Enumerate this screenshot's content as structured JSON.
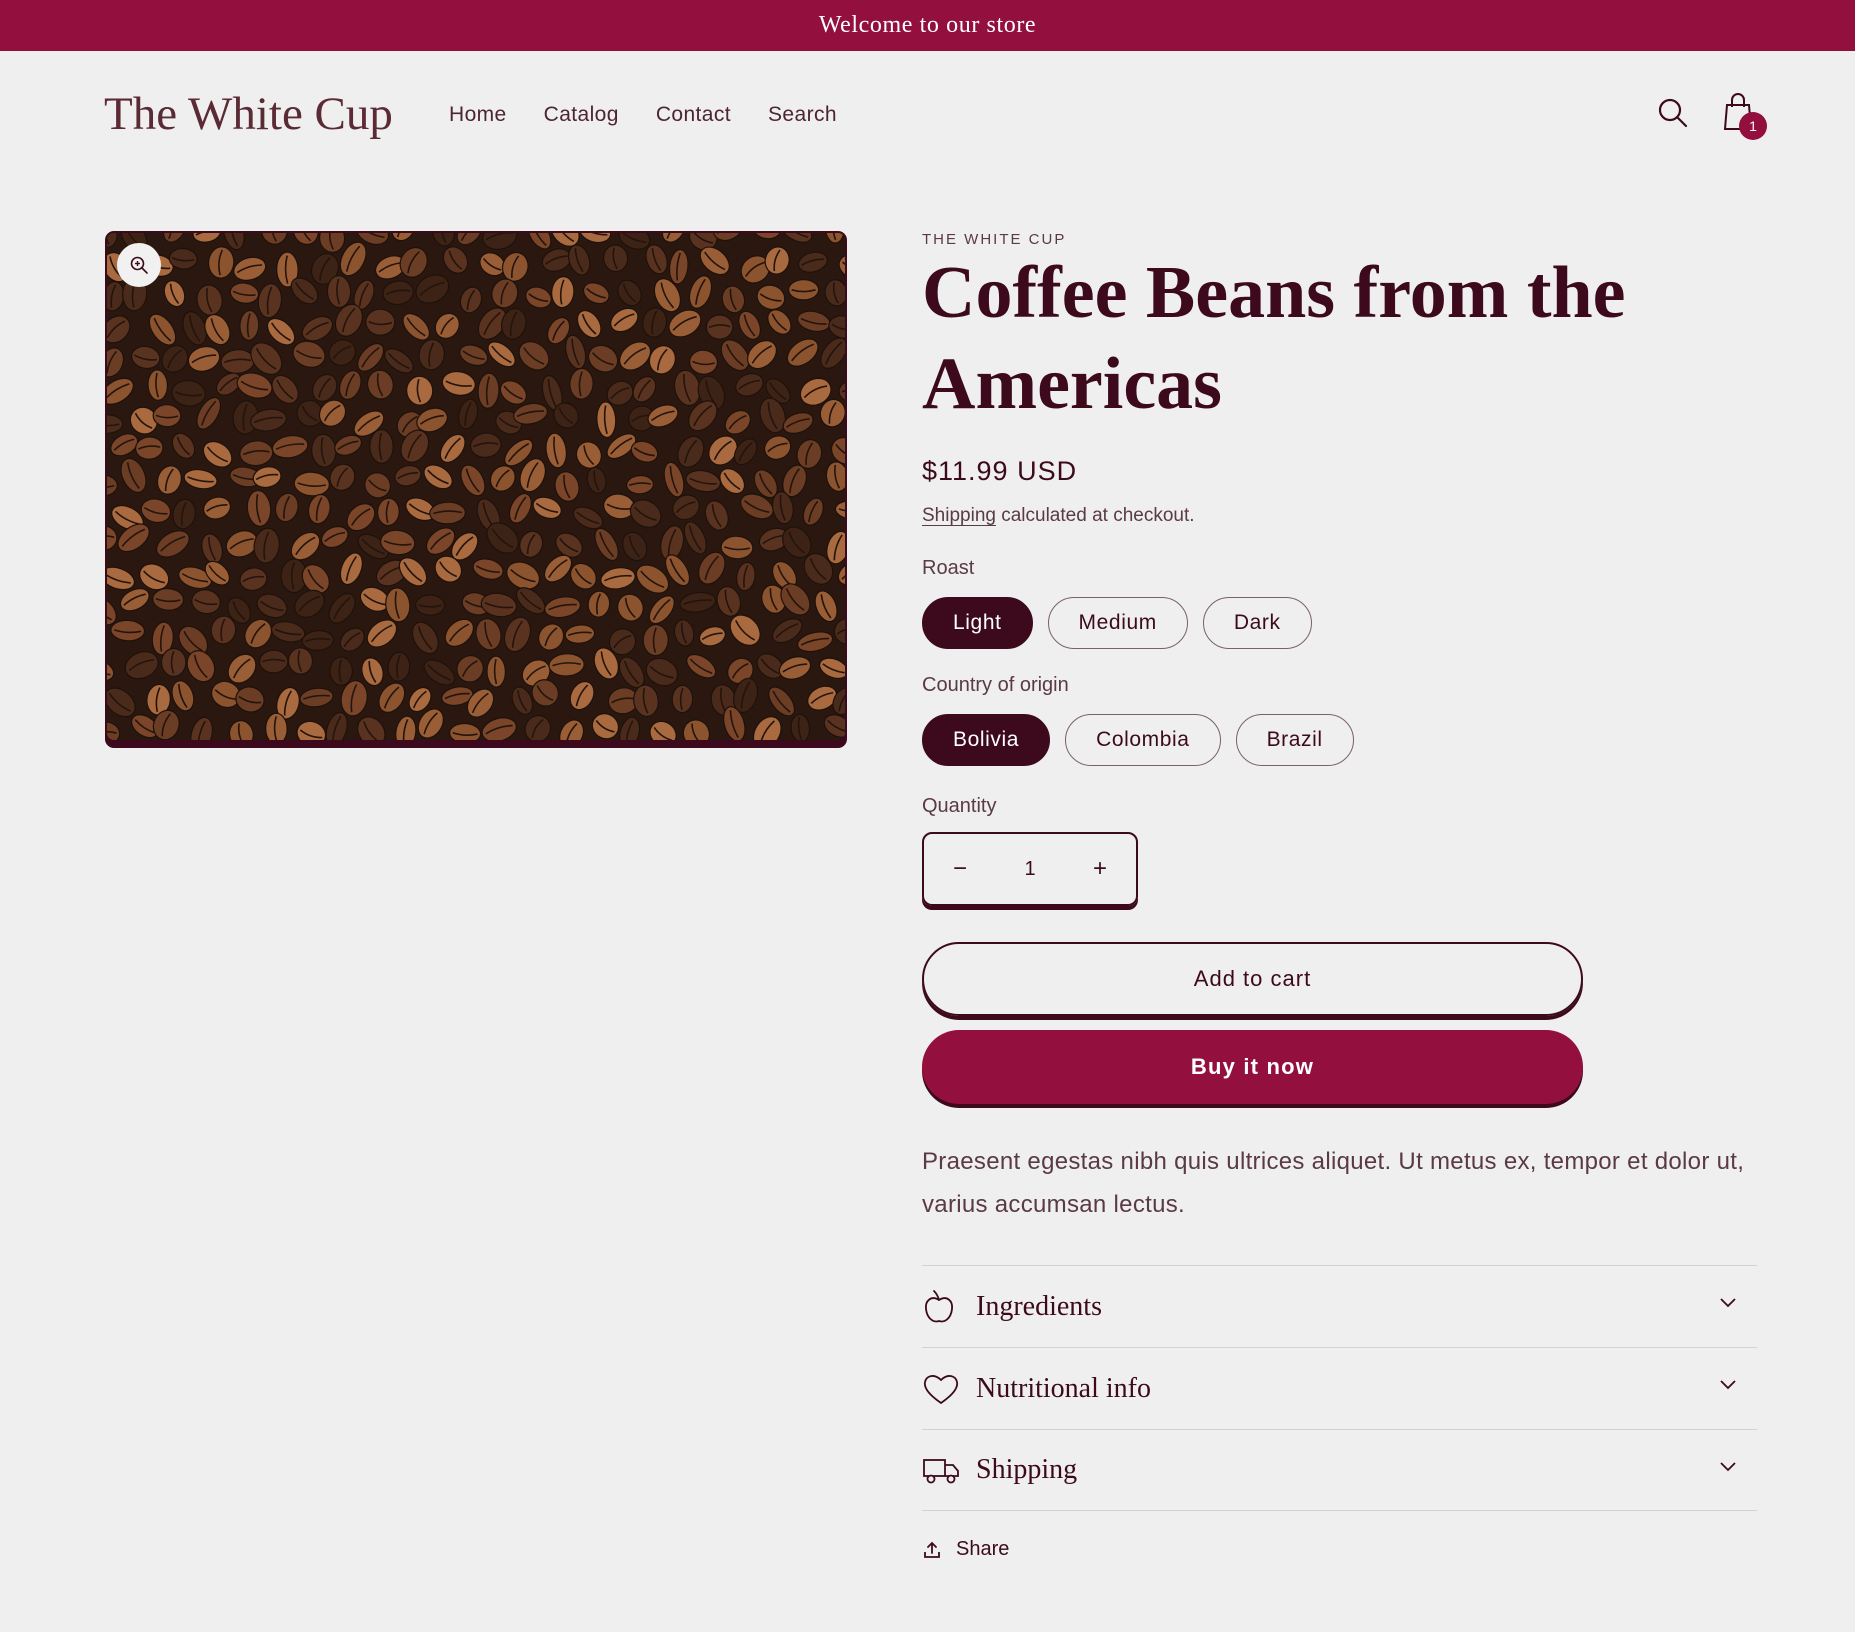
{
  "announcement": {
    "text": "Welcome to our store"
  },
  "header": {
    "logo": "The White Cup",
    "nav": [
      "Home",
      "Catalog",
      "Contact",
      "Search"
    ],
    "cart_count": "1"
  },
  "product": {
    "vendor": "THE WHITE CUP",
    "title": "Coffee Beans from the Americas",
    "price": "$11.99 USD",
    "shipping_link": "Shipping",
    "shipping_rest": " calculated at checkout.",
    "options": [
      {
        "label": "Roast",
        "values": [
          "Light",
          "Medium",
          "Dark"
        ],
        "selected": "Light"
      },
      {
        "label": "Country of origin",
        "values": [
          "Bolivia",
          "Colombia",
          "Brazil"
        ],
        "selected": "Bolivia"
      }
    ],
    "quantity_label": "Quantity",
    "quantity": "1",
    "quantity_minus": "−",
    "quantity_plus": "+",
    "add_to_cart": "Add to cart",
    "buy_now": "Buy it now",
    "description": "Praesent egestas nibh quis ultrices aliquet. Ut metus ex, tempor et dolor ut, varius accumsan lectus.",
    "accordion": [
      {
        "label": "Ingredients",
        "icon": "apple-icon"
      },
      {
        "label": "Nutritional info",
        "icon": "heart-icon"
      },
      {
        "label": "Shipping",
        "icon": "truck-icon"
      }
    ],
    "share": "Share"
  },
  "colors": {
    "accent": "#930f3e",
    "dark": "#3c0a1c",
    "background": "#efefef"
  }
}
